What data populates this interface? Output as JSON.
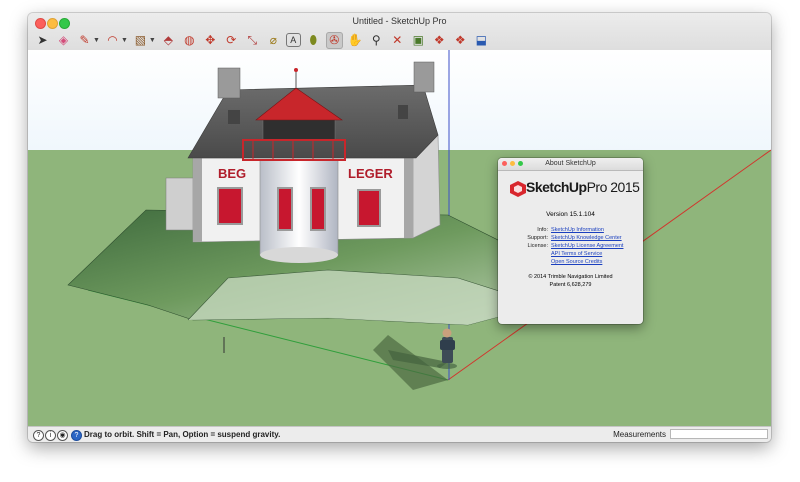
{
  "window": {
    "title": "Untitled - SketchUp Pro"
  },
  "toolbar": {
    "tools": [
      {
        "name": "select-tool",
        "glyph": "➤"
      },
      {
        "name": "eraser-tool",
        "glyph": "◈"
      },
      {
        "name": "line-tool",
        "glyph": "✎"
      },
      {
        "name": "arc-tool",
        "glyph": "◠"
      },
      {
        "name": "rectangle-tool",
        "glyph": "▧"
      },
      {
        "name": "push-pull-tool",
        "glyph": "⬘"
      },
      {
        "name": "offset-tool",
        "glyph": "◍"
      },
      {
        "name": "move-tool",
        "glyph": "✥"
      },
      {
        "name": "rotate-tool",
        "glyph": "⟳"
      },
      {
        "name": "scale-tool",
        "glyph": "⤡"
      },
      {
        "name": "tape-measure-tool",
        "glyph": "⌀"
      },
      {
        "name": "text-tool",
        "glyph": "A"
      },
      {
        "name": "paint-bucket-tool",
        "glyph": "⬮"
      },
      {
        "name": "orbit-tool",
        "glyph": "✇"
      },
      {
        "name": "pan-tool",
        "glyph": "✋"
      },
      {
        "name": "zoom-tool",
        "glyph": "⚲"
      },
      {
        "name": "zoom-extents-tool",
        "glyph": "✕"
      },
      {
        "name": "components-tool",
        "glyph": "▣"
      },
      {
        "name": "warehouse-tool",
        "glyph": "❖"
      },
      {
        "name": "extension-warehouse-tool",
        "glyph": "❖"
      },
      {
        "name": "share-model-tool",
        "glyph": "⬓"
      }
    ]
  },
  "house": {
    "sign_left": "BEG",
    "sign_right": "LEGER"
  },
  "about": {
    "title": "About SketchUp",
    "logo": "SketchUp",
    "logo_pro": "Pro 2015",
    "version": "Version 15.1.104",
    "rows": [
      {
        "label": "Info:",
        "link": "SketchUp Information"
      },
      {
        "label": "Support:",
        "link": "SketchUp Knowledge Center"
      },
      {
        "label": "License:",
        "link": "SketchUp License Agreement"
      },
      {
        "label": "",
        "link": "API Terms of Service"
      },
      {
        "label": "",
        "link": "Open Source Credits"
      }
    ],
    "copyright": "© 2014 Trimble Navigation Limited",
    "patent": "Patent 6,628,279"
  },
  "status": {
    "hint": "Drag to orbit. Shift = Pan, Option = suspend gravity.",
    "measurements_label": "Measurements",
    "measurements_value": ""
  },
  "colors": {
    "ground": "#8fb57b",
    "roof": "#5c5c5c",
    "lantern": "#c8262b",
    "wall": "#f1f1f1",
    "axis_green": "#2e9e3a",
    "axis_red": "#d2342c",
    "axis_blue": "#3c4fc8"
  }
}
